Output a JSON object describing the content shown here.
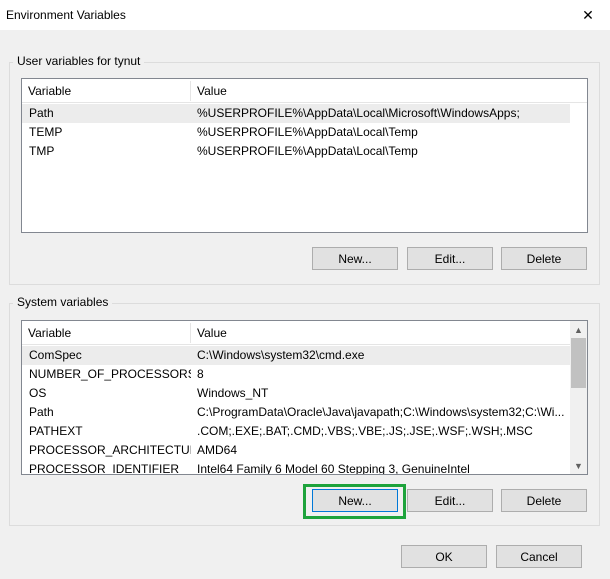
{
  "window": {
    "title": "Environment Variables",
    "close_glyph": "✕"
  },
  "user_vars": {
    "group_label": "User variables for tynut",
    "columns": {
      "variable": "Variable",
      "value": "Value"
    },
    "rows": [
      {
        "variable": "Path",
        "value": "%USERPROFILE%\\AppData\\Local\\Microsoft\\WindowsApps;"
      },
      {
        "variable": "TEMP",
        "value": "%USERPROFILE%\\AppData\\Local\\Temp"
      },
      {
        "variable": "TMP",
        "value": "%USERPROFILE%\\AppData\\Local\\Temp"
      }
    ],
    "buttons": {
      "new": "New...",
      "edit": "Edit...",
      "delete": "Delete"
    }
  },
  "system_vars": {
    "group_label": "System variables",
    "columns": {
      "variable": "Variable",
      "value": "Value"
    },
    "rows": [
      {
        "variable": "ComSpec",
        "value": "C:\\Windows\\system32\\cmd.exe"
      },
      {
        "variable": "NUMBER_OF_PROCESSORS",
        "value": "8"
      },
      {
        "variable": "OS",
        "value": "Windows_NT"
      },
      {
        "variable": "Path",
        "value": "C:\\ProgramData\\Oracle\\Java\\javapath;C:\\Windows\\system32;C:\\Wi..."
      },
      {
        "variable": "PATHEXT",
        "value": ".COM;.EXE;.BAT;.CMD;.VBS;.VBE;.JS;.JSE;.WSF;.WSH;.MSC"
      },
      {
        "variable": "PROCESSOR_ARCHITECTURE",
        "value": "AMD64"
      },
      {
        "variable": "PROCESSOR_IDENTIFIER",
        "value": "Intel64 Family 6 Model 60 Stepping 3, GenuineIntel"
      }
    ],
    "buttons": {
      "new": "New...",
      "edit": "Edit...",
      "delete": "Delete"
    },
    "scroll": {
      "up_glyph": "▲",
      "down_glyph": "▼"
    }
  },
  "footer": {
    "ok": "OK",
    "cancel": "Cancel"
  },
  "colors": {
    "highlight": "#1ea33c",
    "focus": "#0078d7"
  }
}
